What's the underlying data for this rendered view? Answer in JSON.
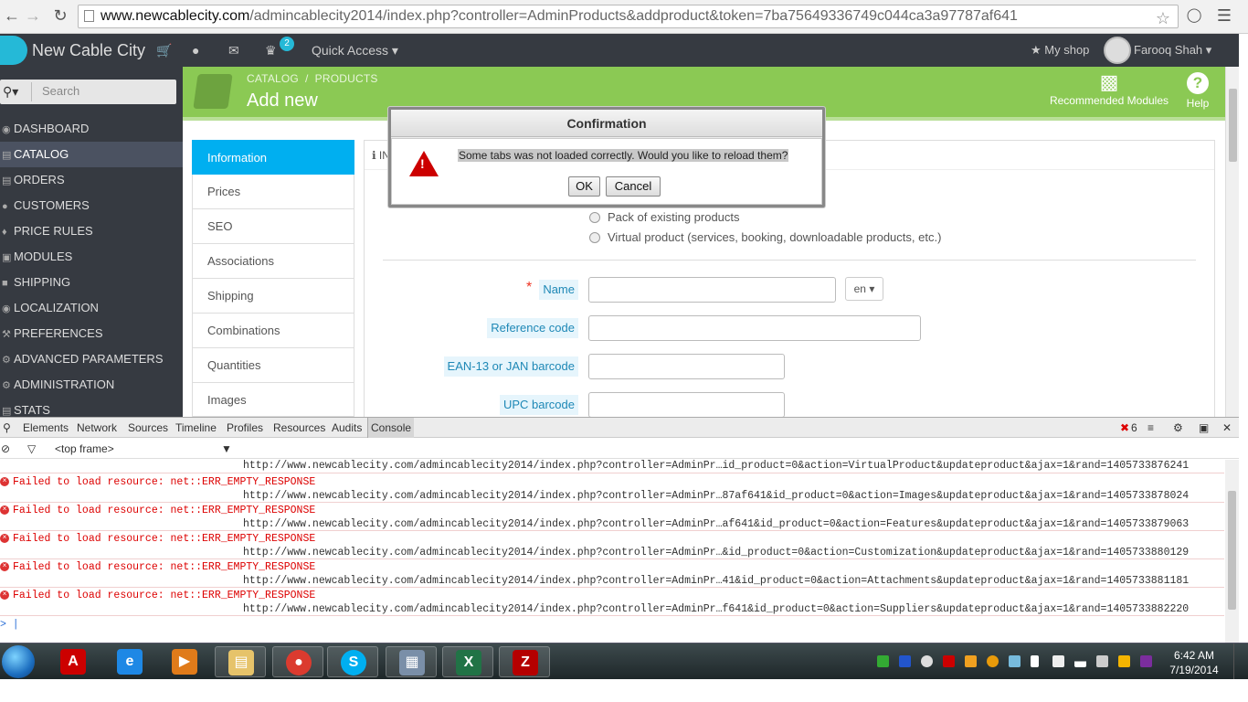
{
  "browser": {
    "url_host": "www.newcablecity.com",
    "url_path": "/admincablecity2014/index.php?controller=AdminProducts&addproduct&token=7ba75649336749c044ca3a97787af641"
  },
  "header": {
    "brand": "New Cable City",
    "notification_count": "2",
    "quick_access": "Quick Access",
    "my_shop": "My shop",
    "user": "Farooq Shah"
  },
  "sidebar": {
    "search_placeholder": "Search",
    "items": [
      {
        "label": "DASHBOARD"
      },
      {
        "label": "CATALOG"
      },
      {
        "label": "ORDERS"
      },
      {
        "label": "CUSTOMERS"
      },
      {
        "label": "PRICE RULES"
      },
      {
        "label": "MODULES"
      },
      {
        "label": "SHIPPING"
      },
      {
        "label": "LOCALIZATION"
      },
      {
        "label": "PREFERENCES"
      },
      {
        "label": "ADVANCED PARAMETERS"
      },
      {
        "label": "ADMINISTRATION"
      },
      {
        "label": "STATS"
      }
    ]
  },
  "page": {
    "breadcrumb_1": "CATALOG",
    "breadcrumb_sep": "/",
    "breadcrumb_2": "PRODUCTS",
    "title": "Add new",
    "recommended_modules": "Recommended Modules",
    "help": "Help"
  },
  "tabs": [
    "Information",
    "Prices",
    "SEO",
    "Associations",
    "Shipping",
    "Combinations",
    "Quantities",
    "Images"
  ],
  "form": {
    "panel_header": "IN",
    "radio_pack": "Pack of existing products",
    "radio_virtual": "Virtual product (services, booking, downloadable products, etc.)",
    "name_label": "Name",
    "lang": "en",
    "reference_label": "Reference code",
    "ean_label": "EAN-13 or JAN barcode",
    "upc_label": "UPC barcode"
  },
  "dialog": {
    "title": "Confirmation",
    "message": "Some tabs was not loaded correctly. Would you like to reload them?",
    "ok": "OK",
    "cancel": "Cancel"
  },
  "devtools": {
    "tabs": [
      "Elements",
      "Network",
      "Sources",
      "Timeline",
      "Profiles",
      "Resources",
      "Audits",
      "Console"
    ],
    "error_count": "6",
    "frame": "<top frame>",
    "first_url": "http://www.newcablecity.com/admincablecity2014/index.php?controller=AdminPr…id_product=0&action=VirtualProduct&updateproduct&ajax=1&rand=1405733876241",
    "errors": [
      {
        "msg": "Failed to load resource: net::ERR_EMPTY_RESPONSE",
        "url": "http://www.newcablecity.com/admincablecity2014/index.php?controller=AdminPr…87af641&id_product=0&action=Images&updateproduct&ajax=1&rand=1405733878024"
      },
      {
        "msg": "Failed to load resource: net::ERR_EMPTY_RESPONSE",
        "url": "http://www.newcablecity.com/admincablecity2014/index.php?controller=AdminPr…af641&id_product=0&action=Features&updateproduct&ajax=1&rand=1405733879063"
      },
      {
        "msg": "Failed to load resource: net::ERR_EMPTY_RESPONSE",
        "url": "http://www.newcablecity.com/admincablecity2014/index.php?controller=AdminPr…&id_product=0&action=Customization&updateproduct&ajax=1&rand=1405733880129"
      },
      {
        "msg": "Failed to load resource: net::ERR_EMPTY_RESPONSE",
        "url": "http://www.newcablecity.com/admincablecity2014/index.php?controller=AdminPr…41&id_product=0&action=Attachments&updateproduct&ajax=1&rand=1405733881181"
      },
      {
        "msg": "Failed to load resource: net::ERR_EMPTY_RESPONSE",
        "url": "http://www.newcablecity.com/admincablecity2014/index.php?controller=AdminPr…f641&id_product=0&action=Suppliers&updateproduct&ajax=1&rand=1405733882220"
      }
    ],
    "prompt": ">"
  },
  "taskbar": {
    "time": "6:42 AM",
    "date": "7/19/2014",
    "apps": [
      "acrobat-icon",
      "internet-explorer-icon",
      "media-player-icon",
      "explorer-icon",
      "chrome-icon",
      "skype-icon",
      "calculator-icon",
      "excel-icon",
      "filezilla-icon"
    ]
  },
  "colors": {
    "header_bg": "#363a41",
    "green": "#8bc954",
    "tab_active": "#00aff0",
    "error_red": "#dd0000"
  }
}
